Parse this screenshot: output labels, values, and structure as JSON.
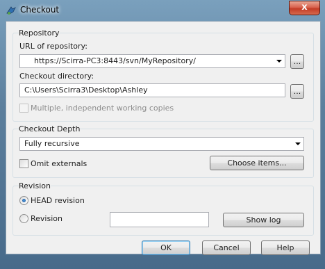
{
  "window": {
    "title": "Checkout",
    "close_glyph": "x"
  },
  "repository": {
    "group_label": "Repository",
    "url_label": "URL of repository:",
    "url_value": "https://Scirra-PC3:8443/svn/MyRepository/",
    "browse_url_label": "...",
    "dir_label": "Checkout directory:",
    "dir_value": "C:\\Users\\Scirra3\\Desktop\\Ashley",
    "browse_dir_label": "...",
    "multiple_label": "Multiple, independent working copies"
  },
  "depth": {
    "group_label": "Checkout Depth",
    "selected": "Fully recursive",
    "omit_externals_label": "Omit externals",
    "choose_items_label": "Choose items..."
  },
  "revision": {
    "group_label": "Revision",
    "head_label": "HEAD revision",
    "revision_label": "Revision",
    "revision_value": "",
    "show_log_label": "Show log"
  },
  "footer": {
    "ok_label": "OK",
    "cancel_label": "Cancel",
    "help_label": "Help"
  },
  "icons": {
    "app": "tortoise-svn-icon"
  }
}
